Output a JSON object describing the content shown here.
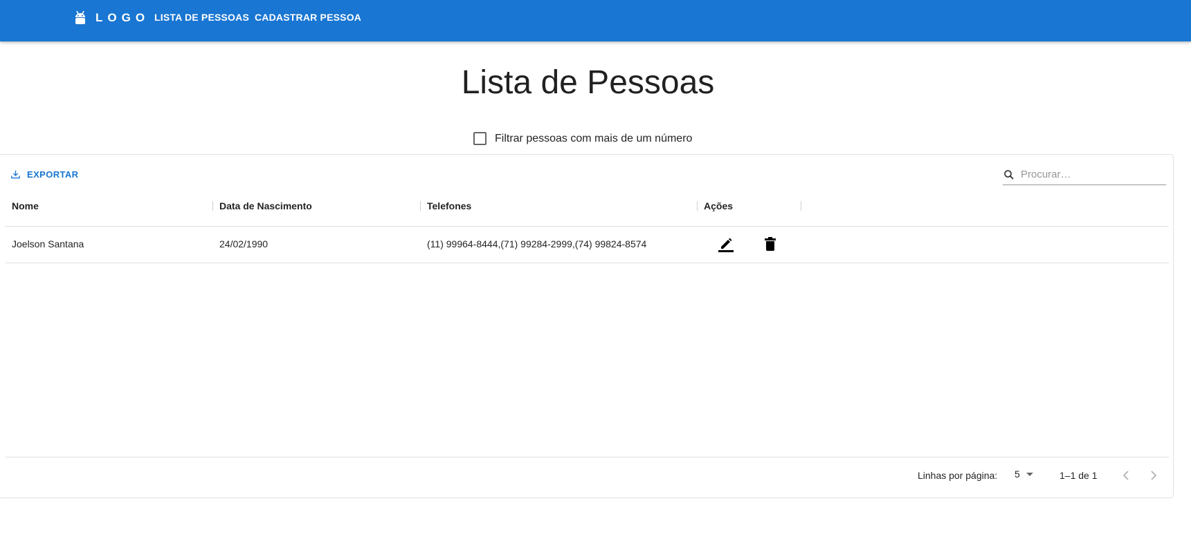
{
  "appbar": {
    "logo_text": "LOGO",
    "nav": [
      {
        "label": "LISTA DE PESSOAS"
      },
      {
        "label": "CADASTRAR PESSOA"
      }
    ]
  },
  "page": {
    "title": "Lista de Pessoas"
  },
  "filter": {
    "label": "Filtrar pessoas com mais de um número",
    "checked": false
  },
  "toolbar": {
    "export_label": "EXPORTAR",
    "search_placeholder": "Procurar…"
  },
  "table": {
    "columns": [
      "Nome",
      "Data de Nascimento",
      "Telefones",
      "Ações"
    ],
    "rows": [
      {
        "nome": "Joelson Santana",
        "nascimento": "24/02/1990",
        "telefones": "(11) 99964-8444,(71) 99284-2999,(74) 99824-8574"
      }
    ]
  },
  "footer": {
    "rows_per_page_label": "Linhas por página:",
    "rows_per_page_value": "5",
    "range": "1–1 de 1"
  },
  "colors": {
    "primary": "#1976d2"
  }
}
